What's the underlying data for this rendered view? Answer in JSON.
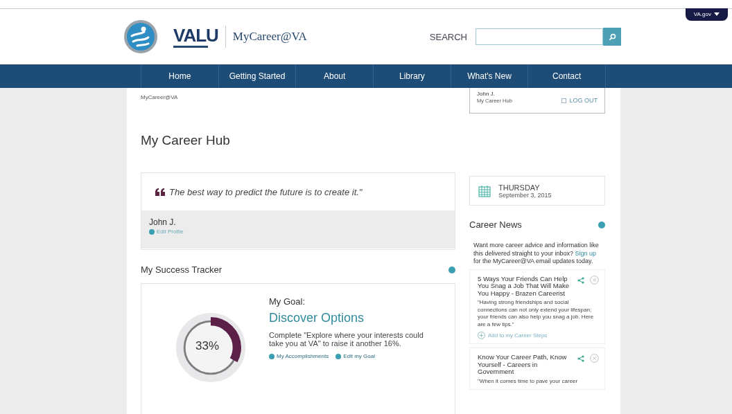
{
  "header": {
    "logo_text": "VALU",
    "site_name": "MyCareer@VA",
    "search_label": "SEARCH",
    "va_menu": "VA.gov"
  },
  "nav": [
    {
      "label": "Home"
    },
    {
      "label": "Getting Started"
    },
    {
      "label": "About"
    },
    {
      "label": "Library"
    },
    {
      "label": "What's New"
    },
    {
      "label": "Contact"
    }
  ],
  "breadcrumb": "MyCareer@VA",
  "user_box": {
    "name": "John J.",
    "subtitle": "My Career Hub",
    "logout": "LOG OUT"
  },
  "page_title": "My Career Hub",
  "quote": {
    "text": "The best way to predict the future is to create it.\"",
    "author": "John J.",
    "edit_link": "Edit Profile"
  },
  "tracker": {
    "title": "My Success Tracker",
    "level": 0.33,
    "reading": "33%",
    "goal_label": "My Goal:",
    "goal_name": "Discover Options",
    "description": "Complete \"Explore where your interests could take you at VA\" to raise it another 16%.",
    "links": [
      "My Accomplishments",
      "Edit my Goal"
    ]
  },
  "date": {
    "weekday": "THURSDAY",
    "date": "September 3, 2015"
  },
  "news": {
    "title": "Career News",
    "intro_before": "Want more career advice and information like this delivered straight to your inbox?",
    "signup_link": "Sign up",
    "intro_after": "for the MyCareer@VA email updates today.",
    "items": [
      {
        "title": "5 Ways Your Friends Can Help You Snag a Job That Will Make You Happy - Brazen Careerist",
        "summary": "\"Having strong friendships and social connections can not only extend your lifespan; your friends can also help you snag a job. Here are a few tips.\"",
        "action": "Add to my Career Steps"
      },
      {
        "title": "Know Your Career Path, Know Yourself - Careers in Government",
        "summary": "\"When it comes time to pave your career"
      }
    ]
  }
}
